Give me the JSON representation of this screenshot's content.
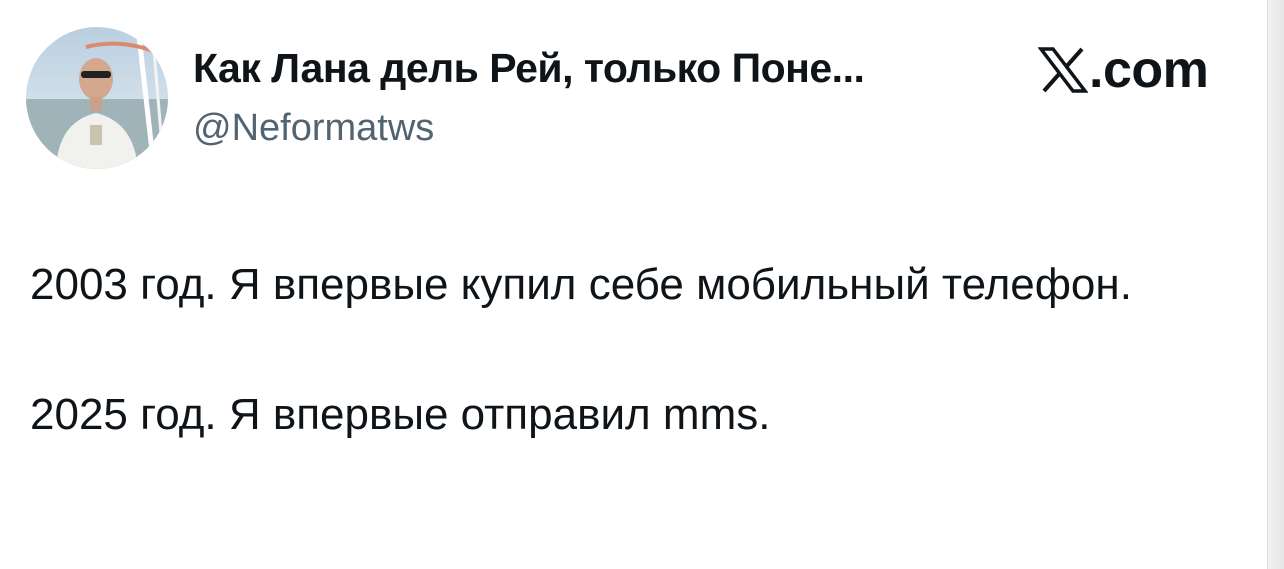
{
  "author": {
    "name": "Как Лана дель Рей, только Поне...",
    "handle": "@Neformatws",
    "avatar_icon": "profile-photo"
  },
  "brand": {
    "icon": "x-logo-icon",
    "text": ".com"
  },
  "tweet": {
    "paragraphs": [
      "2003 год. Я впервые купил себе мобильный телефон.",
      "2025 год. Я впервые отправил mms."
    ]
  },
  "colors": {
    "text": "#0f1419",
    "handle": "#536471",
    "background": "#ffffff"
  }
}
